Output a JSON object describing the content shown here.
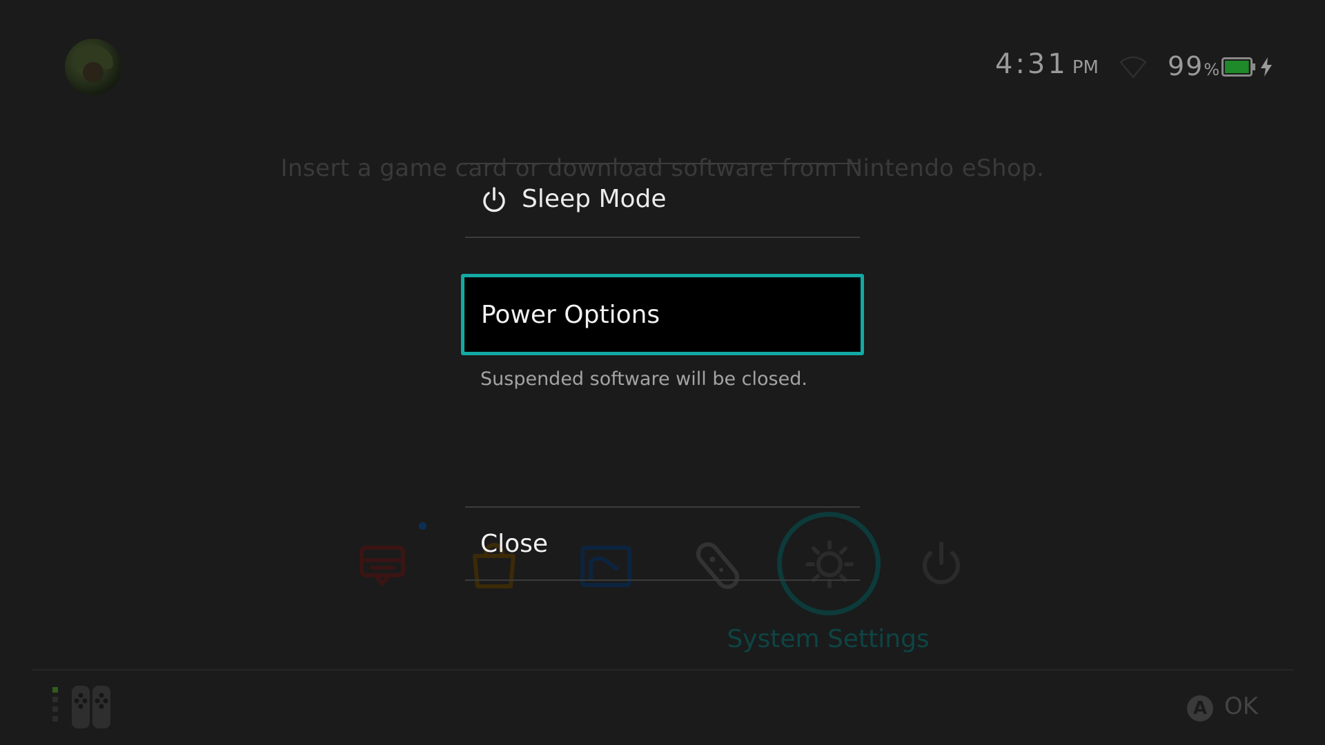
{
  "status_bar": {
    "time": "4:31",
    "ampm": "PM",
    "battery_number": "99",
    "battery_unit": "%",
    "battery_level": 0.99,
    "charging": true,
    "icons": [
      "wifi-icon",
      "battery-icon",
      "charging-bolt-icon"
    ]
  },
  "home": {
    "empty_message": "Insert a game card or download software from Nintendo eShop.",
    "dock": [
      {
        "name": "news-icon",
        "color": "#3b1414"
      },
      {
        "name": "eshop-icon",
        "color": "#3b2a08"
      },
      {
        "name": "album-icon",
        "color": "#0c2440"
      },
      {
        "name": "controllers-icon",
        "color": "#333333"
      },
      {
        "name": "settings-icon",
        "color": "#2b2b2b"
      },
      {
        "name": "power-icon",
        "color": "#2b2b2b"
      }
    ],
    "selected_label": "System Settings"
  },
  "power_menu": {
    "sleep_label": "Sleep Mode",
    "power_options_label": "Power Options",
    "power_options_description": "Suspended software will be closed.",
    "close_label": "Close",
    "accent_color": "#13a9a4"
  },
  "footer": {
    "a_button_glyph": "A",
    "ok_label": "OK"
  }
}
